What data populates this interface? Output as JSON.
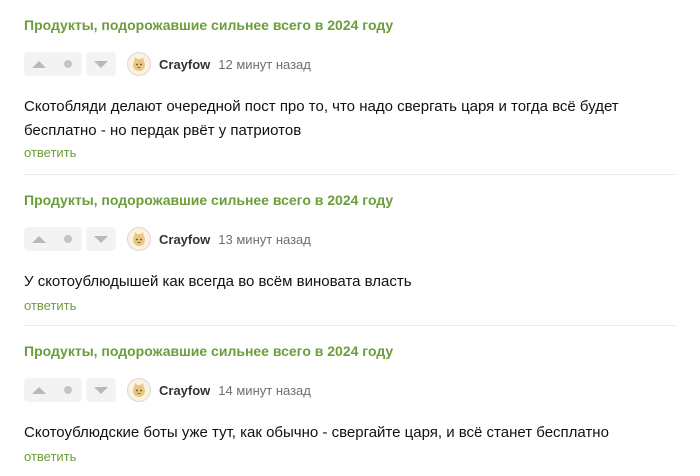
{
  "comments": [
    {
      "post_title": "Продукты, подорожавшие сильнее всего в 2024 году",
      "author": "Crayfow",
      "time": "12 минут назад",
      "text": "Скотобляди делают очередной пост про то, что надо свергать царя и тогда всё будет бесплатно - но пердак рвёт у патриотов",
      "reply_label": "ответить"
    },
    {
      "post_title": "Продукты, подорожавшие сильнее всего в 2024 году",
      "author": "Crayfow",
      "time": "13 минут назад",
      "text": "У скотоублюдышей как всегда во всём виновата власть",
      "reply_label": "ответить"
    },
    {
      "post_title": "Продукты, подорожавшие сильнее всего в 2024 году",
      "author": "Crayfow",
      "time": "14 минут назад",
      "text": "Скотоублюдские боты уже тут, как обычно - свергайте царя, и всё станет бесплатно",
      "reply_label": "ответить"
    }
  ],
  "icons": {
    "upvote": "triangle-up-icon",
    "neutral": "dot-icon",
    "downvote": "triangle-down-icon",
    "avatar": "cat-avatar-icon"
  },
  "colors": {
    "accent_green": "#6b9e3a",
    "vote_gray": "#b9b9b9",
    "time_gray": "#6f6f6f"
  }
}
